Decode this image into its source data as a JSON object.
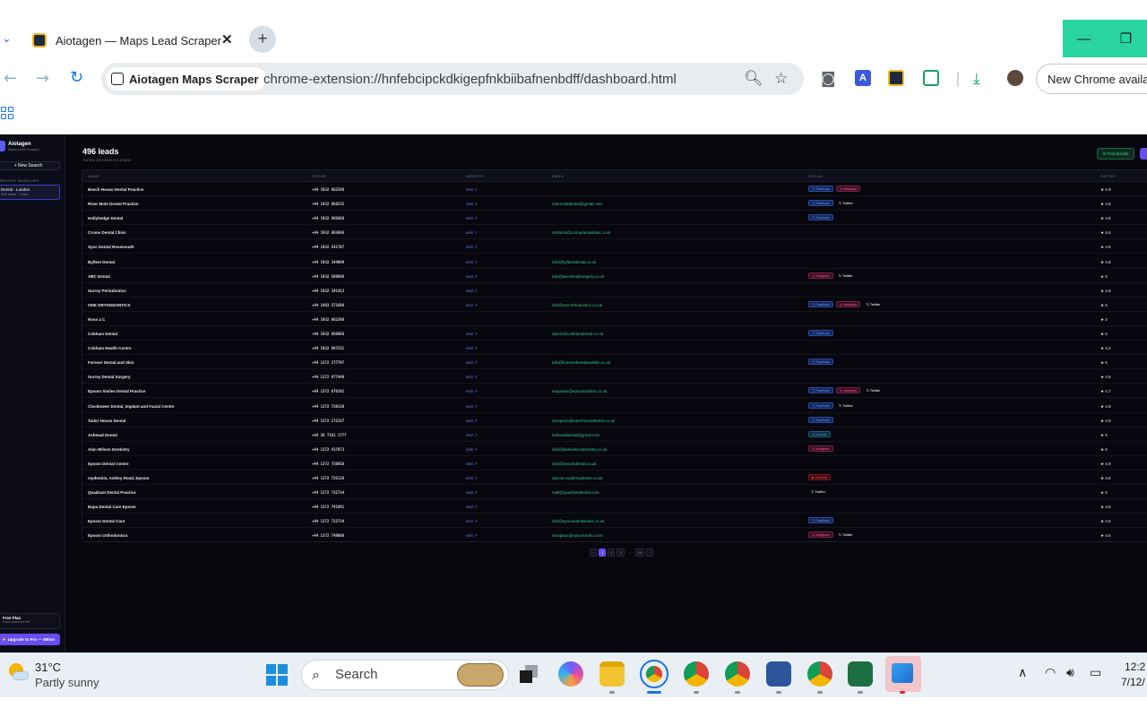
{
  "browser": {
    "tab_title": "Aiotagen — Maps Lead Scraper",
    "site_chip": "Aiotagen Maps Scraper",
    "url": "chrome-extension://hnfebcipckdkigepfnkbiibafnenbdff/dashboard.html",
    "new_chrome": "New Chrome available"
  },
  "sidebar": {
    "brand_name": "Aiotagen",
    "brand_sub": "Maps Lead Scraper",
    "new_search": "+ New Search",
    "recent_heading": "RECENT SEARCHES",
    "recent_item_title": "Dental · London",
    "recent_item_sub": "496 leads · Done",
    "plan_title": "Free Plan",
    "plan_sub": "5 free searches left",
    "upgrade": "⚡ Upgrade to Pro — $9/mo"
  },
  "main": {
    "title": "496 leads",
    "subtitle": "Across 16 zones in London",
    "find_emails": "✉ Find Emails",
    "columns": [
      "NAME",
      "PHONE",
      "WEBSITE",
      "EMAIL",
      "SOCIAL",
      "RATING"
    ],
    "rows": [
      {
        "name": "Beech House Dental Practice",
        "phone": "+44 1932 862288",
        "website": "visit ↗",
        "email": "",
        "social": [
          "Facebook",
          "Instagram"
        ],
        "rating": "★ 4.9"
      },
      {
        "name": "River Mole Dental Practice",
        "phone": "+44 1932 868232",
        "website": "visit ↗",
        "email": "rivermoledental@gmail.com",
        "social": [
          "Facebook",
          "Twitter"
        ],
        "rating": "★ 4.8"
      },
      {
        "name": "Hollyhedge Dental",
        "phone": "+44 1932 865888",
        "website": "visit ↗",
        "email": "",
        "social": [
          "Facebook"
        ],
        "rating": "★ 4.8"
      },
      {
        "name": "Crome Dental Clinic",
        "phone": "+44 1932 863686",
        "website": "visit ↗",
        "email": "%20info@cromedentalclinic.com",
        "social": [],
        "rating": "★ 4.9"
      },
      {
        "name": "Sync Dental Rosemouth",
        "phone": "+44 1932 541707",
        "website": "visit ↗",
        "email": "",
        "social": [],
        "rating": "★ 4.8"
      },
      {
        "name": "Byfleet Dental",
        "phone": "+44 1932 344909",
        "website": "visit ↗",
        "email": "info@byfleetdental.co.uk",
        "social": [],
        "rating": "★ 4.8"
      },
      {
        "name": "ABC Dental",
        "phone": "+44 1932 589888",
        "website": "visit ↗",
        "email": "info@abcdentalsurgery.co.uk",
        "social": [
          "Instagram",
          "Twitter"
        ],
        "rating": "★ 5"
      },
      {
        "name": "Surrey Periodontics",
        "phone": "+44 1932 341413",
        "website": "visit ↗",
        "email": "",
        "social": [],
        "rating": "★ 4.9"
      },
      {
        "name": "ONE ORTHODONTICS",
        "phone": "+44 1483 571686",
        "website": "visit ↗",
        "email": "info@oneorthodontics.co.uk",
        "social": [
          "Facebook",
          "Instagram",
          "Twitter"
        ],
        "rating": "★ 5"
      },
      {
        "name": "Ross a C",
        "phone": "+44 1932 862298",
        "website": "",
        "email": "",
        "social": [],
        "rating": "★ 3"
      },
      {
        "name": "Cobham Dental",
        "phone": "+44 1932 866966",
        "website": "visit ↗",
        "email": "admin@cobhamdental.co.uk",
        "social": [
          "Facebook"
        ],
        "rating": "★ 5"
      },
      {
        "name": "Cobham Health Centre",
        "phone": "+44 1932 867231",
        "website": "visit ↗",
        "email": "",
        "social": [],
        "rating": "★ 4.2"
      },
      {
        "name": "Forever Dental and Skin",
        "phone": "+44 1372 277797",
        "website": "visit ↗",
        "email": "info@foreverdentalandskin.co.uk",
        "social": [
          "Facebook"
        ],
        "rating": "★ 5"
      },
      {
        "name": "Surrey Dental Surgery",
        "phone": "+44 1372 877448",
        "website": "visit ↗",
        "email": "",
        "social": [],
        "rating": "★ 4.9"
      },
      {
        "name": "Epsom Smiles Dental Practice",
        "phone": "+44 1372 670191",
        "website": "visit ↗",
        "email": "enquiries@epsomsmiles.co.uk",
        "social": [
          "Facebook",
          "Instagram",
          "Twitter"
        ],
        "rating": "★ 4.7"
      },
      {
        "name": "Clocktower Dental, Implant and Facial Centre",
        "phone": "+44 1372 738136",
        "website": "visit ↗",
        "email": "",
        "social": [
          "Facebook",
          "Twitter"
        ],
        "rating": "★ 4.9"
      },
      {
        "name": "Tudor House Dental",
        "phone": "+44 1372 272337",
        "website": "visit ↗",
        "email": "reception@tudorhousedental.co.uk",
        "social": [
          "Facebook"
        ],
        "rating": "★ 4.9"
      },
      {
        "name": "Ashtead Dental",
        "phone": "+44 20 7161 1777",
        "website": "visit ↗",
        "email": "ashteaddental@gmail.com",
        "social": [
          "LinkedIn"
        ],
        "rating": "★ 5"
      },
      {
        "name": "Alan Wilson Dentistry",
        "phone": "+44 1372 417873",
        "website": "visit ↗",
        "email": "info@alanwilsondentistry.co.uk",
        "social": [
          "Instagram"
        ],
        "rating": "★ 5"
      },
      {
        "name": "Epsom Dental Centre",
        "phone": "+44 1372 738658",
        "website": "visit ↗",
        "email": "info@epsomdental.co.uk",
        "social": [],
        "rating": "★ 4.9"
      },
      {
        "name": "mydentist, Ashley Road, Epsom",
        "phone": "+44 1372 725128",
        "website": "visit ↗",
        "email": "epsom-ow@mydentist.co.uk",
        "social": [
          "YouTube"
        ],
        "rating": "★ 4.6"
      },
      {
        "name": "Quadrant Dental Practice",
        "phone": "+44 1372 722734",
        "website": "visit ↗",
        "email": "mail@quadrantdental.com",
        "social": [
          "Twitter"
        ],
        "rating": "★ 5"
      },
      {
        "name": "Bupa Dental Care Epsom",
        "phone": "+44 1372 741881",
        "website": "visit ↗",
        "email": "",
        "social": [],
        "rating": "★ 4.8"
      },
      {
        "name": "Epsom Dental Care",
        "phone": "+44 1372 722734",
        "website": "visit ↗",
        "email": "info@epsomdentalcare.co.uk",
        "social": [
          "Facebook"
        ],
        "rating": "★ 4.5"
      },
      {
        "name": "Epsom Orthodontics",
        "phone": "+44 1372 748088",
        "website": "visit ↗",
        "email": "reception@epsomortho.com",
        "social": [
          "Instagram",
          "Twitter"
        ],
        "rating": "★ 4.5"
      }
    ],
    "pagination": [
      "‹",
      "1",
      "2",
      "3",
      "…",
      "20",
      "›"
    ]
  },
  "taskbar": {
    "temperature": "31°C",
    "condition": "Partly sunny",
    "search_placeholder": "Search",
    "time": "12:2",
    "date": "7/12/"
  }
}
